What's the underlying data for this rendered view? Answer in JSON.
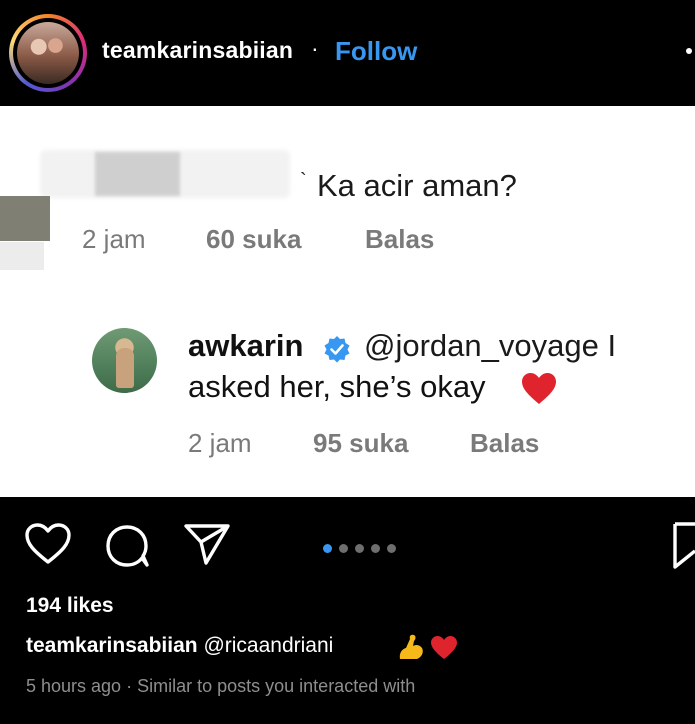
{
  "header": {
    "username": "teamkarinsabiian",
    "separator": "·",
    "follow_label": "Follow"
  },
  "post": {
    "comment1": {
      "text": "Ka acir aman?",
      "time": "2 jam",
      "likes": "60 suka",
      "reply_label": "Balas"
    },
    "reply": {
      "username": "awkarin",
      "mention": "@jordan_voyage I",
      "text_line2": "asked her, she’s okay",
      "time": "2 jam",
      "likes": "95 suka",
      "reply_label": "Balas"
    }
  },
  "actions": {
    "icons": [
      "heart-icon",
      "comment-icon",
      "share-icon",
      "bookmark-icon"
    ],
    "carousel": {
      "count": 5,
      "active": 1
    }
  },
  "footer": {
    "likes": "194 likes",
    "caption_user": "teamkarinsabiian",
    "caption_text": "@ricaandriani",
    "timestamp": "5 hours ago",
    "timestamp_sep": "·",
    "suggestion": "Similar to posts you interacted with"
  },
  "colors": {
    "accent": "#3897f0",
    "heart": "#e0242e",
    "muted": "#8e8e8e"
  }
}
